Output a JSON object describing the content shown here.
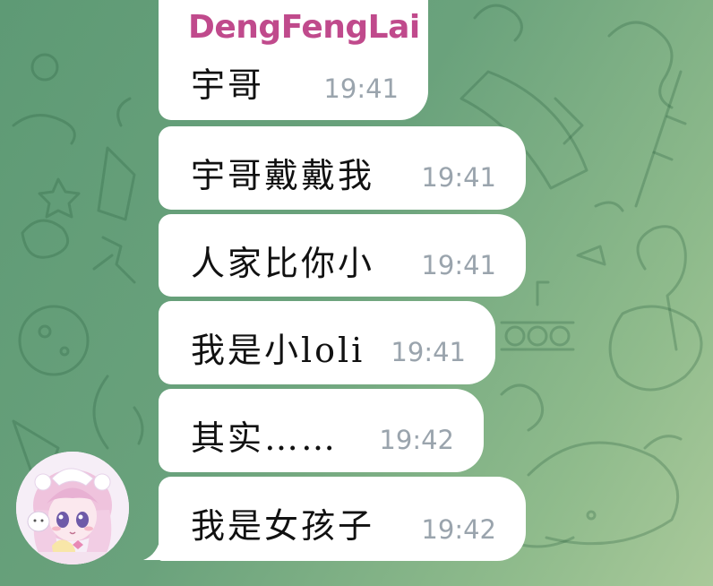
{
  "chat": {
    "sender_name": "DengFengLai",
    "messages": [
      {
        "text": "宇哥",
        "time": "19:41"
      },
      {
        "text": "宇哥戴戴我",
        "time": "19:41"
      },
      {
        "text": "人家比你小",
        "time": "19:41"
      },
      {
        "text": "我是小loli",
        "time": "19:41"
      },
      {
        "text": "其实……",
        "time": "19:42"
      },
      {
        "text": "我是女孩子",
        "time": "19:42"
      }
    ]
  },
  "colors": {
    "sender_name": "#c04a8c",
    "bubble": "#ffffff",
    "time_text": "#9aa4ad",
    "background": "#6aa27c"
  }
}
